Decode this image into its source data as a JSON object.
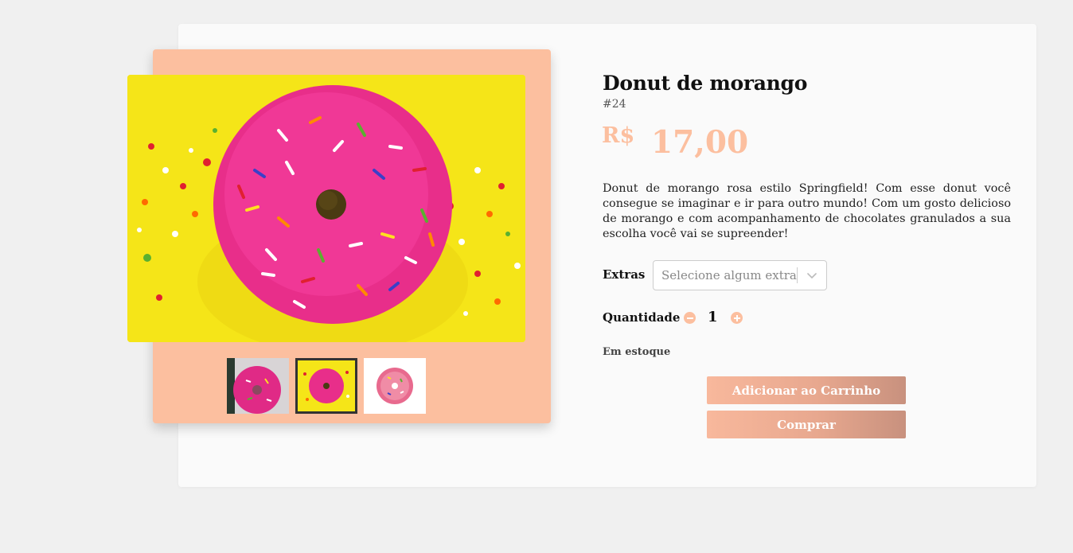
{
  "product": {
    "title": "Donut de morango",
    "sku": "#24",
    "currency": "R$",
    "price": "17,00",
    "description": "Donut de morango rosa estilo Springfield! Com esse donut você consegue se imaginar e ir para outro mundo! Com um gosto delicioso de morango e com acompanhamento de chocolates granulados a sua escolha você vai se supreender!",
    "stock_status": "Em estoque"
  },
  "extras": {
    "label": "Extras",
    "placeholder": "Selecione algum extra"
  },
  "quantity": {
    "label": "Quantidade",
    "value": "1"
  },
  "actions": {
    "add_to_cart": "Adicionar ao Carrinho",
    "buy": "Comprar"
  },
  "gallery": {
    "selected_thumbnail": 2,
    "thumbnail_count": 3
  },
  "colors": {
    "accent": "#fcbf9f",
    "page_background": "#f0f0f0",
    "card_background": "#fafafa"
  },
  "icons": {
    "select_chevron": "chevron-down-icon",
    "decrement": "minus-circle-icon",
    "increment": "plus-circle-icon"
  }
}
